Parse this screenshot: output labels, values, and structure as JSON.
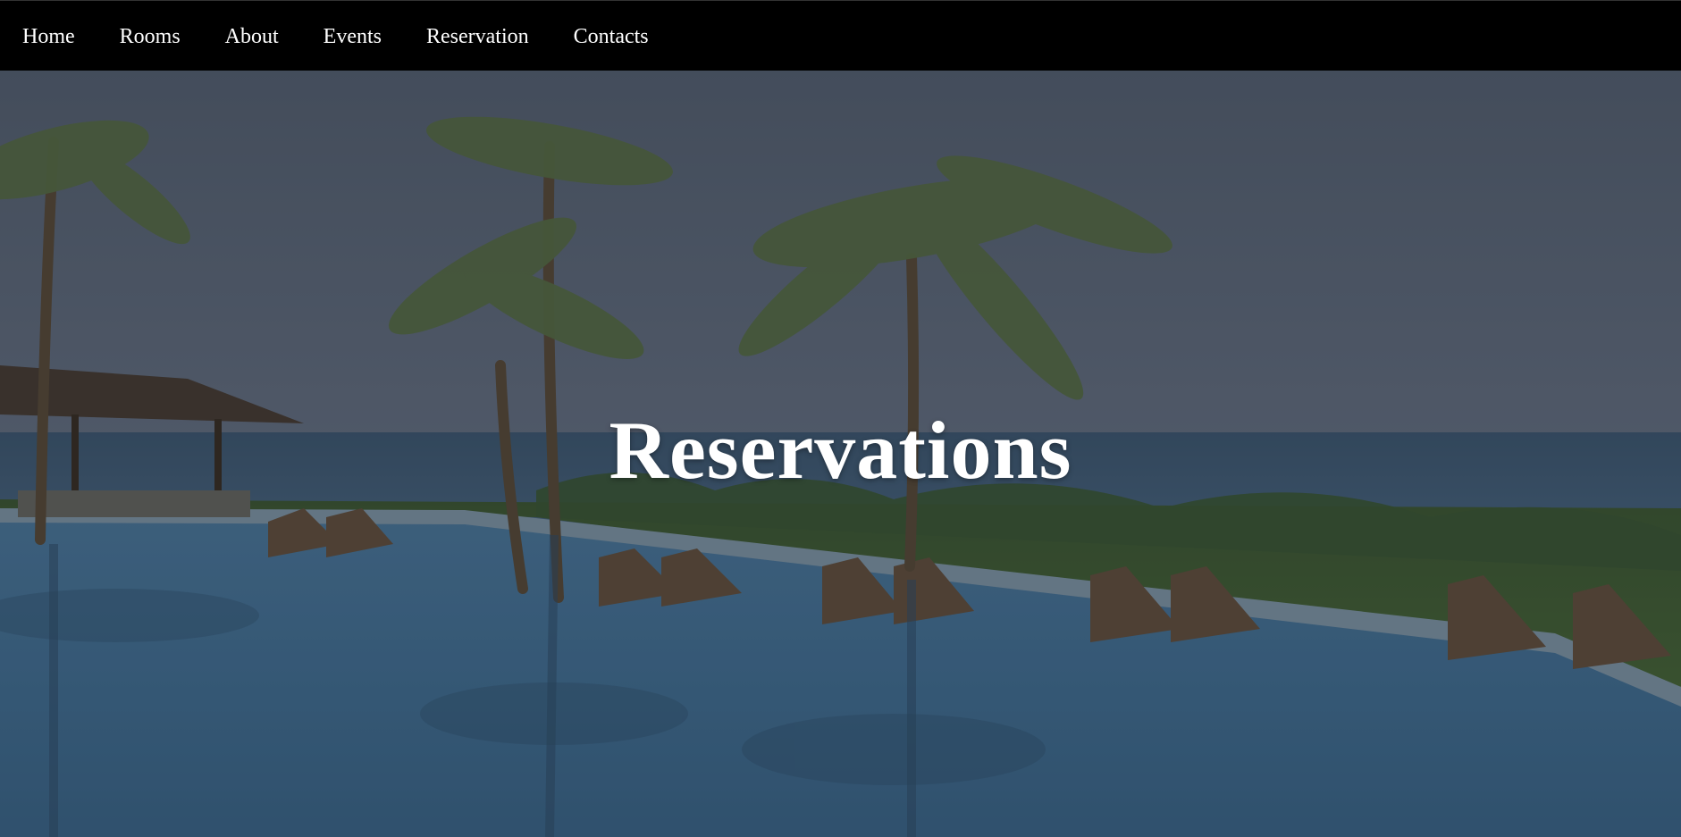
{
  "nav": {
    "items": [
      "Home",
      "Rooms",
      "About",
      "Events",
      "Reservation",
      "Contacts"
    ]
  },
  "hero": {
    "title": "Reservations",
    "image_alt": "resort-pool-with-palm-trees"
  },
  "colors": {
    "navbar_bg": "#000000",
    "nav_text": "#ffffff",
    "title_text": "#ffffff",
    "overlay": "#1b2330"
  }
}
